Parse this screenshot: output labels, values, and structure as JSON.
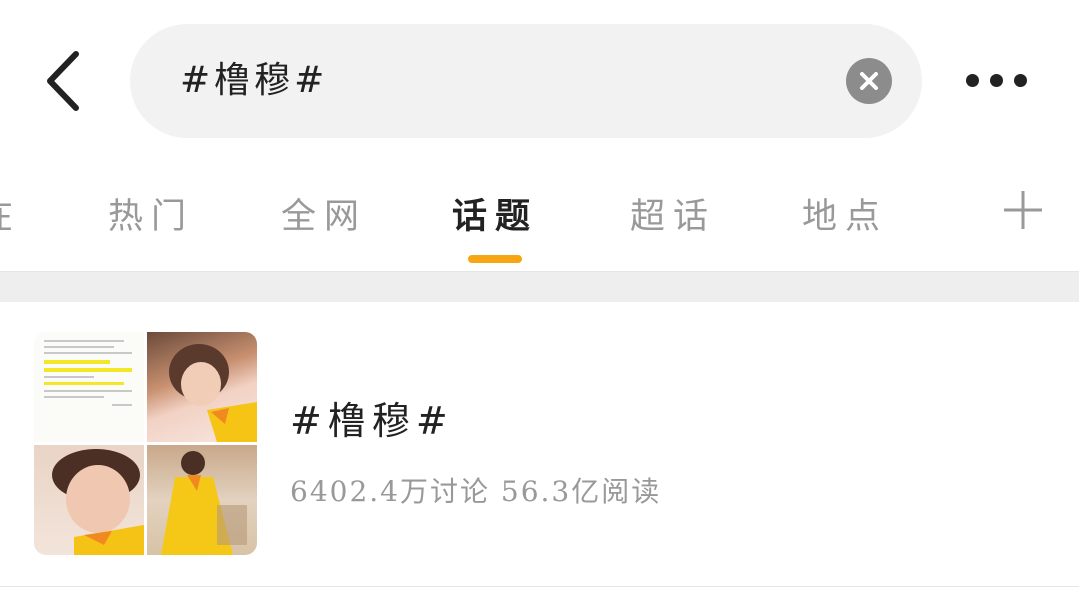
{
  "header": {
    "search_value": "#橹穆#"
  },
  "tabs": [
    {
      "label": "在"
    },
    {
      "label": "热门"
    },
    {
      "label": "全网"
    },
    {
      "label": "话题",
      "active": true
    },
    {
      "label": "超话"
    },
    {
      "label": "地点"
    }
  ],
  "topic": {
    "title": "#橹穆#",
    "stats": "6402.4万讨论 56.3亿阅读"
  },
  "colors": {
    "accent": "#f7a613",
    "search_bg": "#f2f2f2",
    "clear_bg": "#8c8c8c",
    "band": "#eeeeee"
  },
  "icons": [
    "back-arrow-icon",
    "clear-icon",
    "more-icon",
    "plus-icon"
  ]
}
